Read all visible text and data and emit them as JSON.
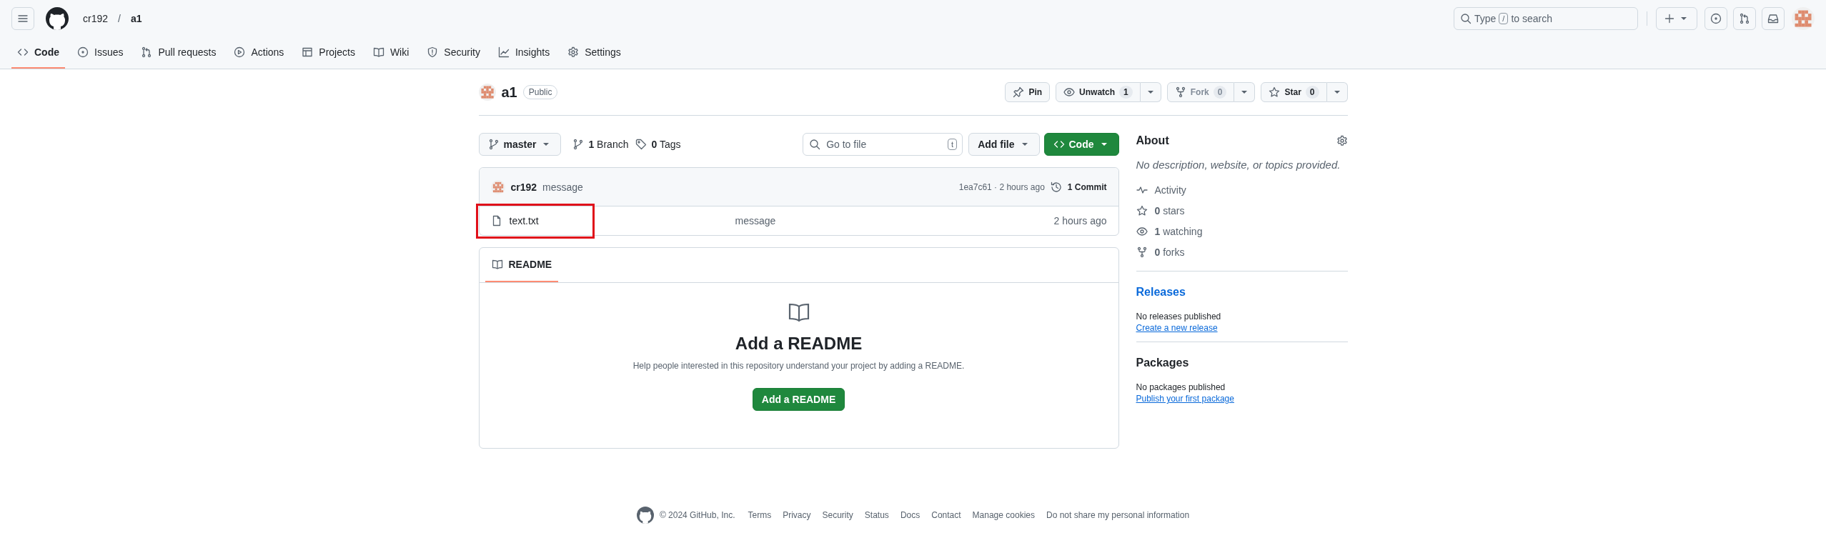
{
  "header": {
    "owner": "cr192",
    "separator": "/",
    "repo": "a1",
    "search": {
      "placeholder_start": "Type",
      "key": "/",
      "placeholder_end": "to search"
    }
  },
  "tabs": [
    {
      "label": "Code",
      "selected": true
    },
    {
      "label": "Issues",
      "selected": false
    },
    {
      "label": "Pull requests",
      "selected": false
    },
    {
      "label": "Actions",
      "selected": false
    },
    {
      "label": "Projects",
      "selected": false
    },
    {
      "label": "Wiki",
      "selected": false
    },
    {
      "label": "Security",
      "selected": false
    },
    {
      "label": "Insights",
      "selected": false
    },
    {
      "label": "Settings",
      "selected": false
    }
  ],
  "repo": {
    "name": "a1",
    "visibility": "Public",
    "actions": [
      {
        "label": "Pin",
        "dropdown": false,
        "disabled": false
      },
      {
        "label": "Unwatch",
        "count": "1",
        "dropdown": true,
        "disabled": false
      },
      {
        "label": "Fork",
        "count": "0",
        "dropdown": true,
        "disabled": true
      },
      {
        "label": "Star",
        "count": "0",
        "dropdown": true,
        "disabled": false
      }
    ]
  },
  "toolbar": {
    "branch": "master",
    "branches": "**1** Branch",
    "tags": "**0** Tags",
    "go_to_file": {
      "placeholder": "Go to file",
      "key": "t"
    },
    "add_file": "Add file",
    "code": "Code"
  },
  "latest_commit": {
    "author": "cr192",
    "message": "message",
    "hash_time": "1ea7c61 · 2 hours ago",
    "commits": "1 Commit"
  },
  "files": [
    {
      "name": "text.txt",
      "message": "message",
      "time": "2 hours ago",
      "highlighted": true
    }
  ],
  "readme": {
    "tab": {
      "label": "README",
      "selected": true
    },
    "heading": "Add a README",
    "text": "Help people interested in this repository understand your project by adding a README.",
    "button": "Add a README"
  },
  "about": {
    "title": "About",
    "description": "No description, website, or topics provided.",
    "stats": [
      "Activity",
      "**0** stars",
      "**1** watching",
      "**0** forks"
    ]
  },
  "releases": {
    "title": "Releases",
    "text": "No releases published",
    "link": "Create a new release"
  },
  "packages": {
    "title": "Packages",
    "text": "No packages published",
    "link": "Publish your first package"
  },
  "footer": {
    "copyright": "© 2024 GitHub, Inc.",
    "links": [
      "Terms",
      "Privacy",
      "Security",
      "Status",
      "Docs",
      "Contact",
      "Manage cookies",
      "Do not share my personal information"
    ]
  }
}
